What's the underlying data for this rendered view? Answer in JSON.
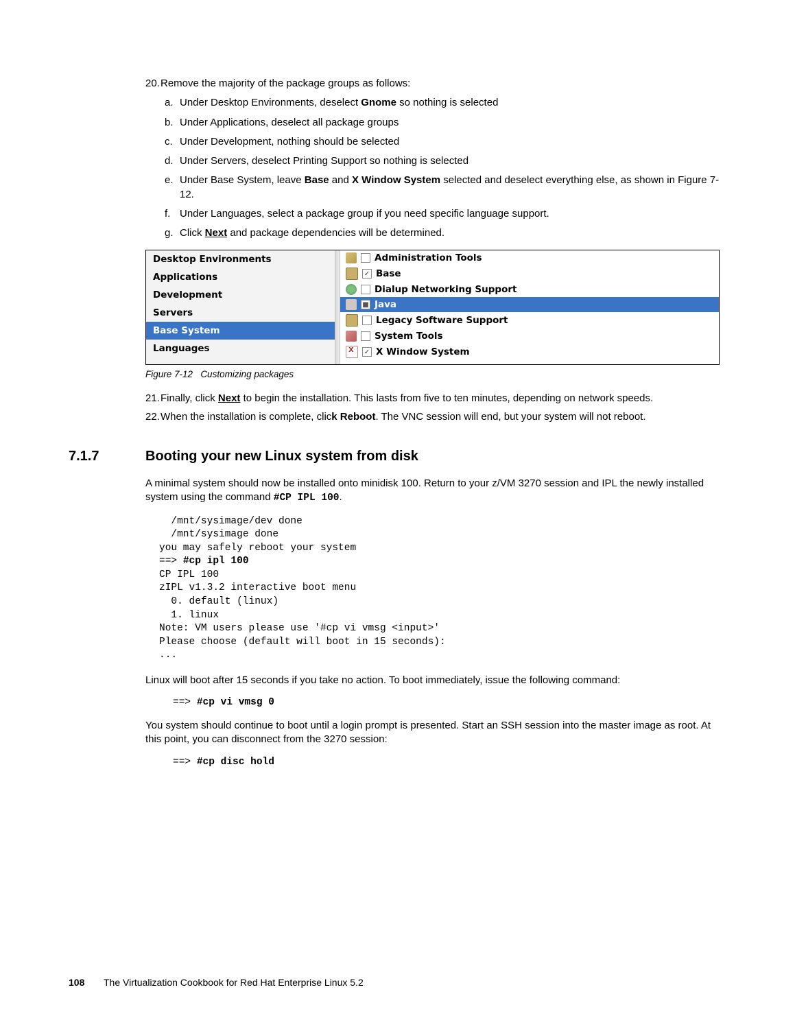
{
  "steps": {
    "s20": {
      "num": "20.",
      "text": "Remove the majority of the package groups as follows:",
      "subs": {
        "a": {
          "letter": "a.",
          "pre": "Under Desktop Environments, deselect ",
          "bold": "Gnome",
          "post": " so nothing is selected"
        },
        "b": {
          "letter": "b.",
          "text": "Under Applications, deselect all package groups"
        },
        "c": {
          "letter": "c.",
          "text": "Under Development, nothing should be selected"
        },
        "d": {
          "letter": "d.",
          "text": "Under Servers, deselect Printing Support so nothing is selected"
        },
        "e": {
          "letter": "e.",
          "pre": "Under Base System, leave ",
          "bold1": "Base",
          "mid": " and ",
          "bold2": "X Window System",
          "post": " selected and deselect everything else, as shown in Figure 7-12."
        },
        "f": {
          "letter": "f.",
          "text": "Under Languages, select a package group if you need specific language support."
        },
        "g": {
          "letter": "g.",
          "pre": "Click ",
          "nextlabel": "Next",
          "post": " and package dependencies will be determined."
        }
      }
    },
    "s21": {
      "num": "21.",
      "pre": "Finally, click ",
      "nextlabel": "Next",
      "post": " to begin the installation. This lasts from five to ten minutes, depending on network speeds."
    },
    "s22": {
      "num": "22.",
      "pre": "When the installation is complete, clic",
      "bold": "k Reboot",
      "post": ". The VNC session will end, but your system will not reboot."
    }
  },
  "figure": {
    "caption_label": "Figure 7-12",
    "caption_text": "Customizing packages",
    "left": {
      "c1": "Desktop Environments",
      "c2": "Applications",
      "c3": "Development",
      "c4": "Servers",
      "c5": "Base System",
      "c6": "Languages"
    },
    "right": {
      "r1": {
        "label": "Administration Tools",
        "check": ""
      },
      "r2": {
        "label": "Base",
        "check": "✓"
      },
      "r3": {
        "label": "Dialup Networking Support",
        "check": ""
      },
      "r4": {
        "label": "Java",
        "check": "■"
      },
      "r5": {
        "label": "Legacy Software Support",
        "check": ""
      },
      "r6": {
        "label": "System Tools",
        "check": ""
      },
      "r7": {
        "label": "X Window System",
        "check": "✓"
      }
    }
  },
  "section": {
    "num": "7.1.7",
    "title": "Booting your new Linux system from disk",
    "para1_pre": "A minimal system should now be installed onto minidisk 100. Return to your z/VM 3270 session and IPL the newly installed system using the command ",
    "para1_cmd": "#CP IPL 100",
    "para1_post": ".",
    "code1": "  /mnt/sysimage/dev done\n  /mnt/sysimage done\nyou may safely reboot your system\n==> #cp ipl 100\nCP IPL 100\nzIPL v1.3.2 interactive boot menu\n  0. default (linux)\n  1. linux\nNote: VM users please use '#cp vi vmsg <input>'\nPlease choose (default will boot in 15 seconds):\n...",
    "code1_boldline": "#cp ipl 100",
    "para2": "Linux will boot after 15 seconds if you take no action. To boot immediately, issue the following command:",
    "cmd2_pre": "==> ",
    "cmd2_bold": "#cp vi vmsg 0",
    "para3": "You system should continue to boot until a login prompt is presented. Start an SSH session into the master image as root. At this point, you can disconnect from the 3270 session:",
    "cmd3_pre": "==> ",
    "cmd3_bold": "#cp disc hold"
  },
  "footer": {
    "page": "108",
    "title": "The Virtualization Cookbook for Red Hat Enterprise Linux 5.2"
  }
}
